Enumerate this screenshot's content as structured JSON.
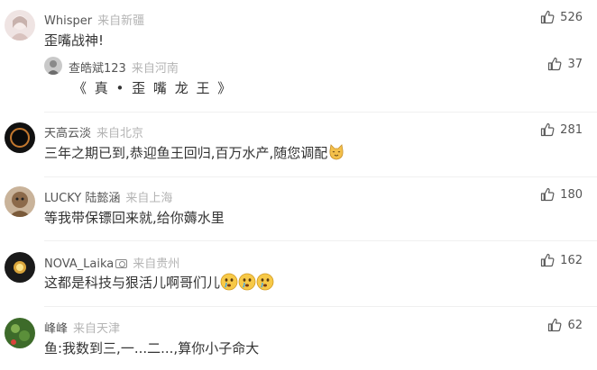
{
  "comments": [
    {
      "user": "Whisper",
      "location": "来自新疆",
      "text": "歪嘴战神!",
      "likes": "526",
      "avatar_color": "#e8d6d3",
      "replies": [
        {
          "user": "查皓斌123",
          "location": "来自河南",
          "text": "《 真 • 歪 嘴 龙 王 》",
          "likes": "37"
        }
      ]
    },
    {
      "user": "天高云淡",
      "location": "来自北京",
      "text": "三年之期已到,恭迎鱼王回归,百万水产,随您调配",
      "likes": "281",
      "emoji": "cat-face"
    },
    {
      "user": "LUCKY 陆懿涵",
      "location": "来自上海",
      "text": "等我带保镖回来就,给你薅水里",
      "likes": "180"
    },
    {
      "user": "NOVA_Laika",
      "location": "来自贵州",
      "text": "这都是科技与狠活儿啊哥们儿",
      "likes": "162",
      "emoji": "crying-face"
    },
    {
      "user": "峰峰",
      "location": "来自天津",
      "text": "鱼:我数到三,一...二...,算你小子命大",
      "likes": "62"
    }
  ],
  "icons": {
    "like": "thumbs-up-icon"
  },
  "colors": {
    "username": "#555555",
    "location": "#b4b4b4",
    "text": "#333333"
  }
}
